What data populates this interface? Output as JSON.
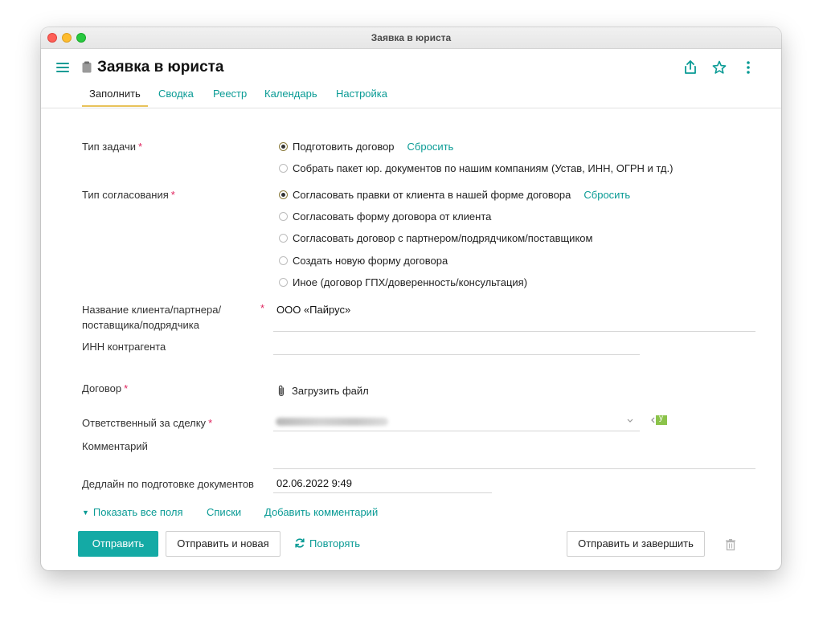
{
  "window": {
    "title": "Заявка в юриста"
  },
  "header": {
    "title": "Заявка в юриста",
    "tabs": [
      "Заполнить",
      "Сводка",
      "Реестр",
      "Календарь",
      "Настройка"
    ]
  },
  "form": {
    "task_type": {
      "label": "Тип задачи",
      "options": [
        "Подготовить договор",
        "Собрать пакет юр. документов по нашим компаниям (Устав, ИНН, ОГРН и тд.)"
      ],
      "selected_index": 0,
      "reset_label": "Сбросить"
    },
    "approval_type": {
      "label": "Тип согласования",
      "options": [
        "Согласовать правки от клиента в нашей форме договора",
        "Согласовать форму договора от клиента",
        "Согласовать договор с партнером/подрядчиком/поставщиком",
        "Создать новую форму договора",
        "Иное (договор ГПХ/доверенность/консультация)"
      ],
      "selected_index": 0,
      "reset_label": "Сбросить"
    },
    "client_name": {
      "label_line1": "Название клиента/партнера/",
      "label_line2": "поставщика/подрядчика",
      "value": "ООО «Пайрус»"
    },
    "inn": {
      "label": "ИНН контрагента",
      "value": ""
    },
    "contract": {
      "label": "Договор",
      "upload_label": "Загрузить файл"
    },
    "responsible": {
      "label": "Ответственный за сделку",
      "badge": "y"
    },
    "comment": {
      "label": "Комментарий",
      "value": ""
    },
    "deadline": {
      "label": "Дедлайн по подготовке документов",
      "value": "02.06.2022 9:49"
    },
    "required_mark": "*"
  },
  "links": {
    "show_all": "Показать все поля",
    "lists": "Списки",
    "add_comment": "Добавить комментарий"
  },
  "buttons": {
    "send": "Отправить",
    "send_new": "Отправить и новая",
    "repeat": "Повторять",
    "send_finish": "Отправить и завершить"
  },
  "colors": {
    "accent": "#14aaa5",
    "required": "#e0245e",
    "tab_indicator": "#e8c25a",
    "badge": "#8bc34a"
  }
}
